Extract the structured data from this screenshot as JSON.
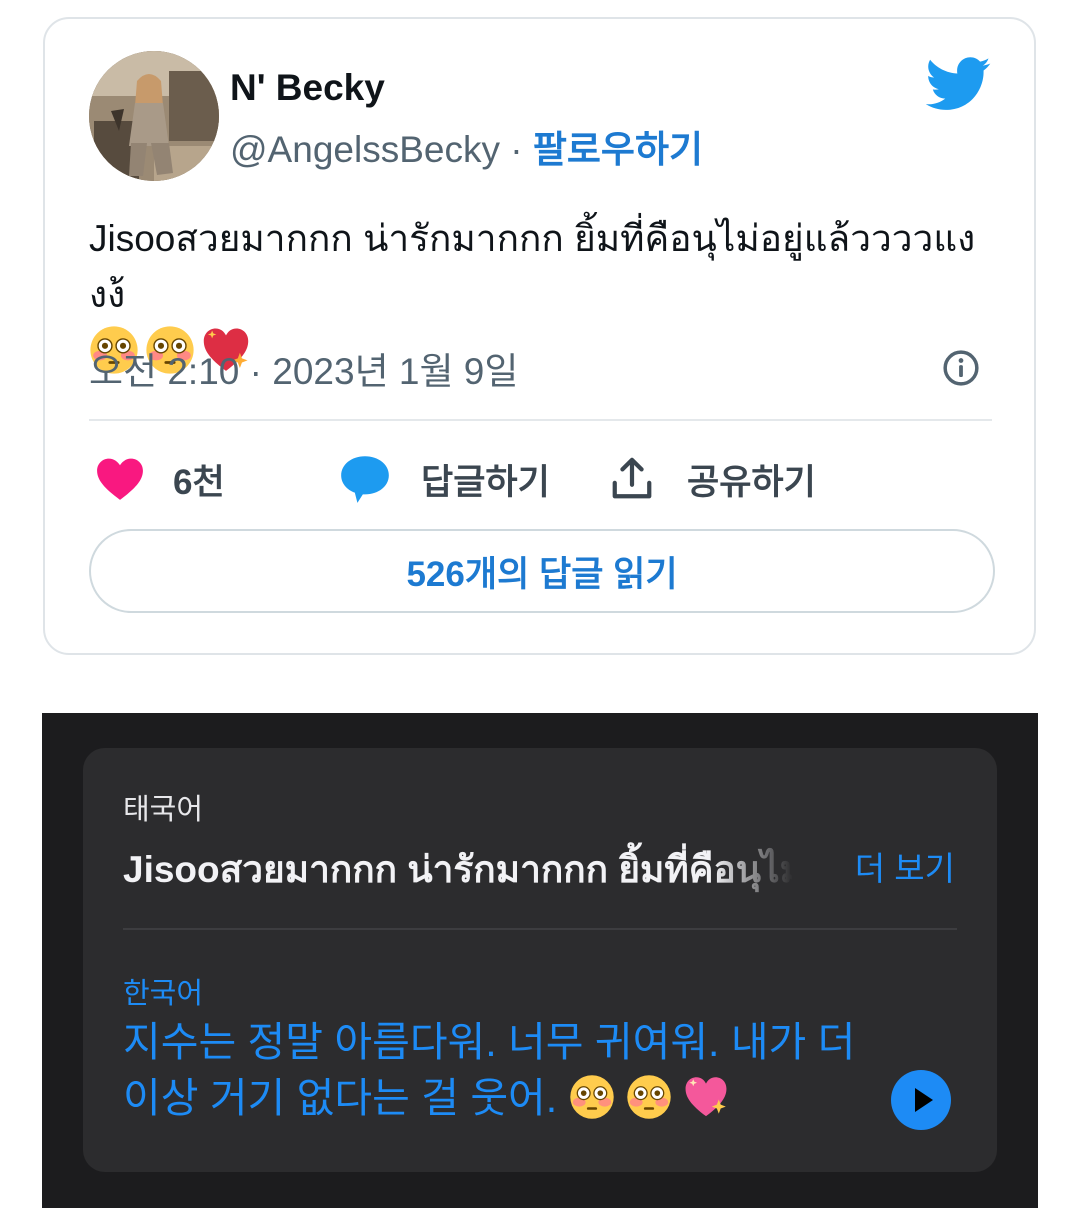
{
  "tweet": {
    "author_name": "N' Becky",
    "handle": "@AngelssBecky",
    "separator": " · ",
    "follow_label": "팔로우하기",
    "text": "Jisooสวยมากกก น่ารักมากกก ยิ้มที่คือนุไม่อยู่แล้ววววแงงง้",
    "emojis": [
      "flushed-face-icon",
      "flushed-face-icon",
      "sparkling-heart-icon"
    ],
    "timestamp": "오전 2:10 · 2023년 1월 9일",
    "likes_count": "6천",
    "reply_label": "답글하기",
    "share_label": "공유하기",
    "read_replies_label": "526개의 답글 읽기",
    "colors": {
      "accent": "#1d7ad1",
      "like": "#f91880",
      "reply": "#1d9bf0",
      "twitter": "#1d9bf0"
    }
  },
  "translation": {
    "source_language": "태국어",
    "source_text": "Jisooสวยมากกก น่ารักมากกก ยิ้มที่คือนุไม่อยู่แล้ววววแงงง้",
    "more_label": "더 보기",
    "target_language": "한국어",
    "target_text": "지수는 정말 아름다워. 너무 귀여워. 내가 더 이상 거기 없다는 걸 웃어.",
    "colors": {
      "accent": "#1d8bf5",
      "panel": "#1c1c1e",
      "card": "#2c2c2e"
    }
  }
}
